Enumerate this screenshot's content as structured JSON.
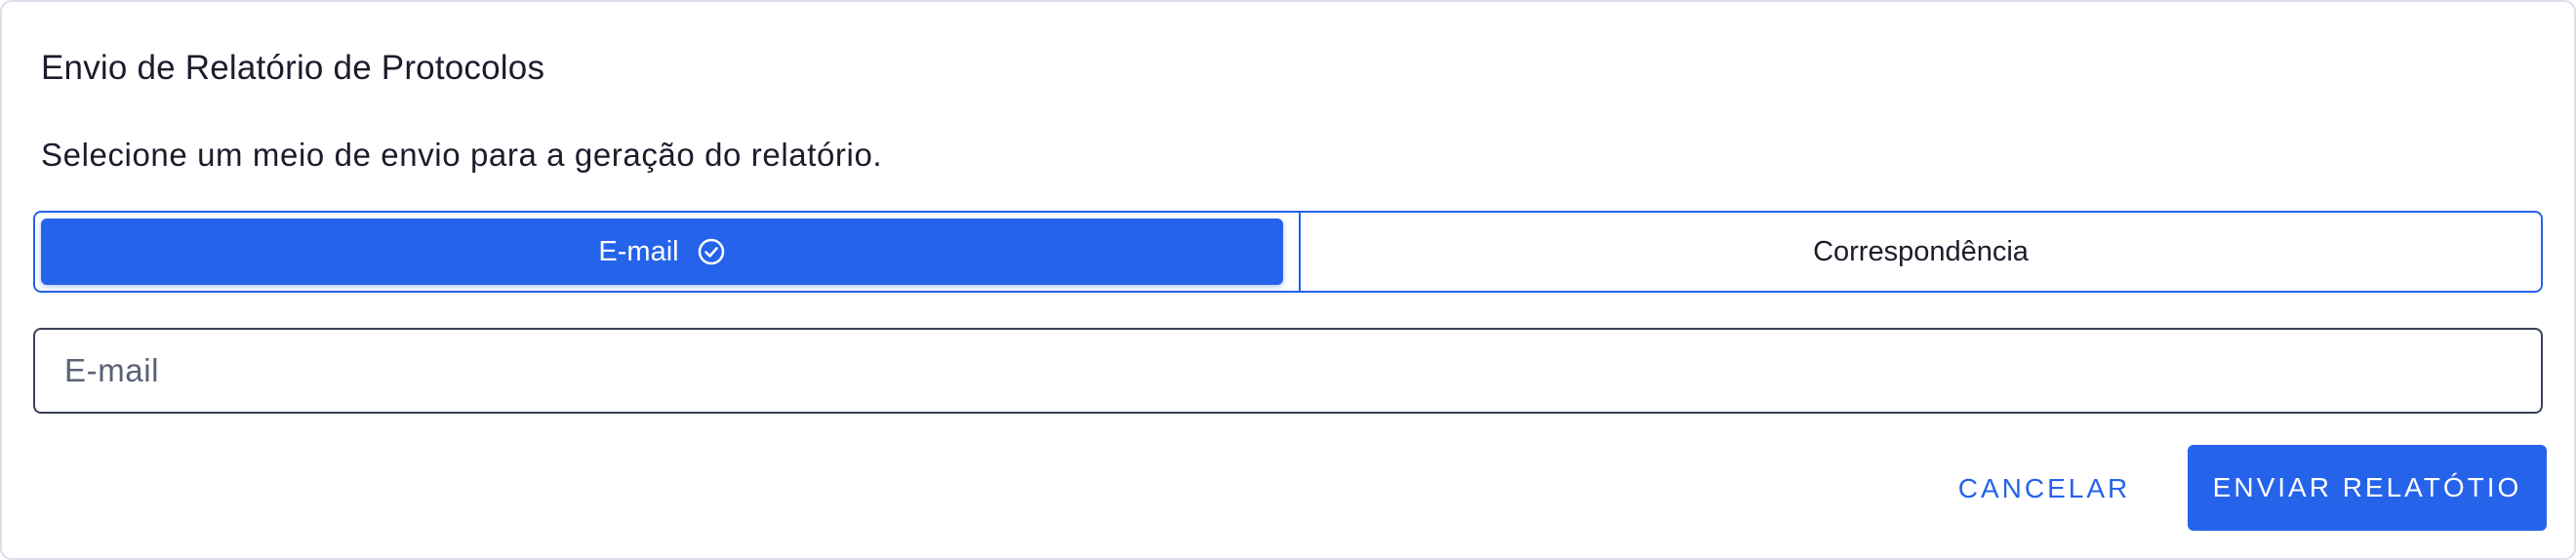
{
  "dialog": {
    "title": "Envio de Relatório de Protocolos",
    "subtitle": "Selecione um meio de envio para a geração do relatório."
  },
  "delivery_options": {
    "items": [
      {
        "label": "E-mail",
        "selected": true,
        "icon": "check-circle-icon"
      },
      {
        "label": "Correspondência",
        "selected": false
      }
    ]
  },
  "email_input": {
    "placeholder": "E-mail",
    "value": ""
  },
  "actions": {
    "cancel_label": "CANCELAR",
    "submit_label": "ENVIAR RELATÓTIO"
  },
  "colors": {
    "accent": "#2563eb",
    "text": "#1b1d2b",
    "border": "#dcdde9"
  }
}
